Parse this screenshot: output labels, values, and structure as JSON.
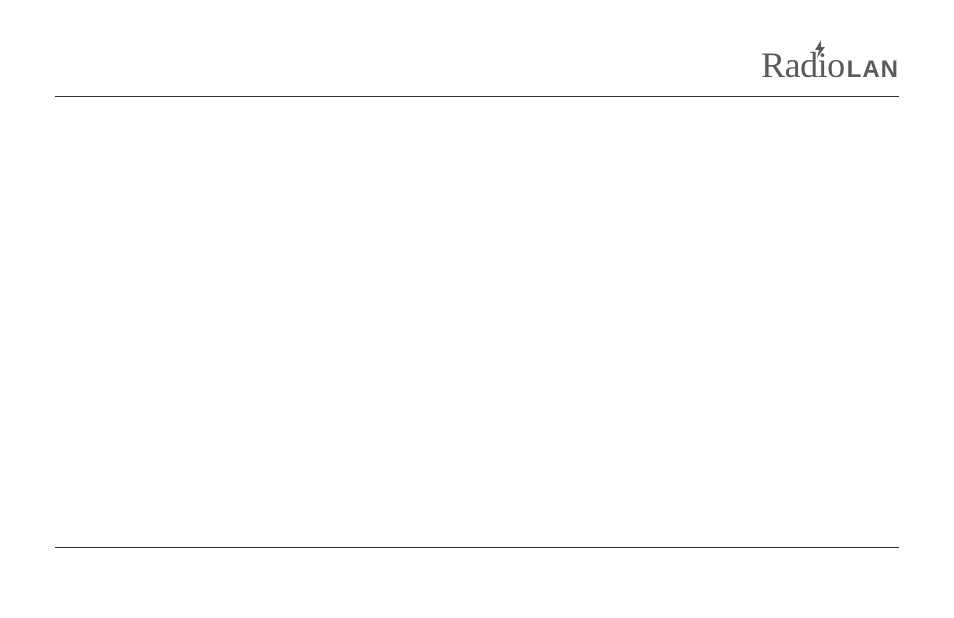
{
  "header": {
    "logo_radio": "Radio",
    "logo_lan": "LAN"
  }
}
